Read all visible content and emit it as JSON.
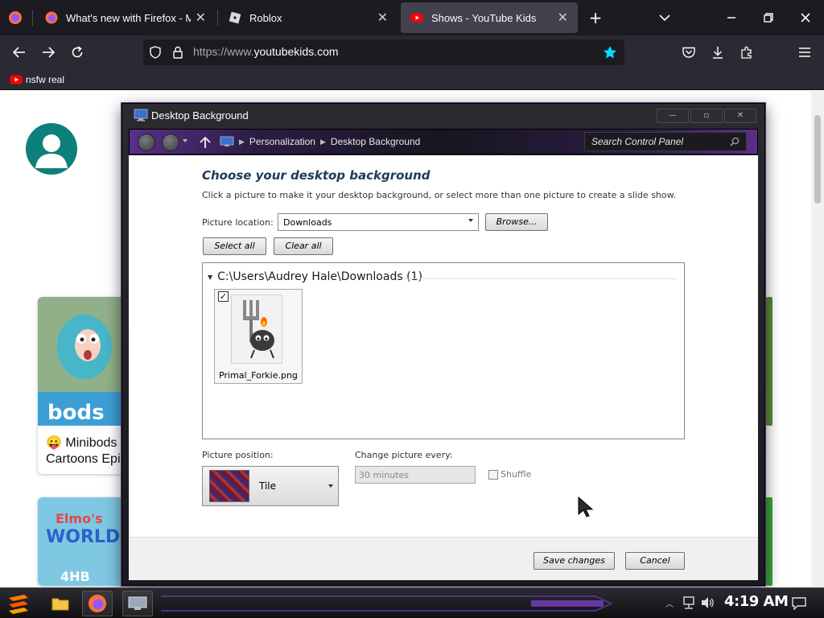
{
  "browser": {
    "tabs": [
      {
        "title": "What's new with Firefox - Mo"
      },
      {
        "title": "Roblox"
      },
      {
        "title": "Shows - YouTube Kids"
      }
    ],
    "url": {
      "prefix": "https://www.",
      "domain": "youtubekids.com"
    },
    "bookmarks": [
      {
        "label": "nsfw real"
      }
    ]
  },
  "page": {
    "cards": [
      {
        "title_line1": "😛 Minibods",
        "title_line2": "Cartoons Epi"
      }
    ]
  },
  "dialog": {
    "title": "Desktop Background",
    "breadcrumb": [
      "Personalization",
      "Desktop Background"
    ],
    "search_placeholder": "Search Control Panel",
    "heading": "Choose your desktop background",
    "instructions": "Click a picture to make it your desktop background, or select more than one picture to create a slide show.",
    "picture_location_label": "Picture location:",
    "picture_location_value": "Downloads",
    "browse_label": "Browse...",
    "select_all_label": "Select all",
    "clear_all_label": "Clear all",
    "group_header": "C:\\Users\\Audrey Hale\\Downloads (1)",
    "pictures": [
      {
        "name": "Primal_Forkie.png",
        "checked": true
      }
    ],
    "position_label": "Picture position:",
    "position_value": "Tile",
    "change_every_label": "Change picture every:",
    "change_every_value": "30 minutes",
    "shuffle_label": "Shuffle",
    "save_label": "Save changes",
    "cancel_label": "Cancel"
  },
  "taskbar": {
    "clock": "4:19 AM"
  },
  "colors": {
    "firefox_tabbar": "#1c1b22",
    "firefox_toolbar": "#2b2a33",
    "dialog_heading": "#1e3a5a",
    "taskbar": "#111114",
    "accent_purple": "#5a2f8a"
  }
}
